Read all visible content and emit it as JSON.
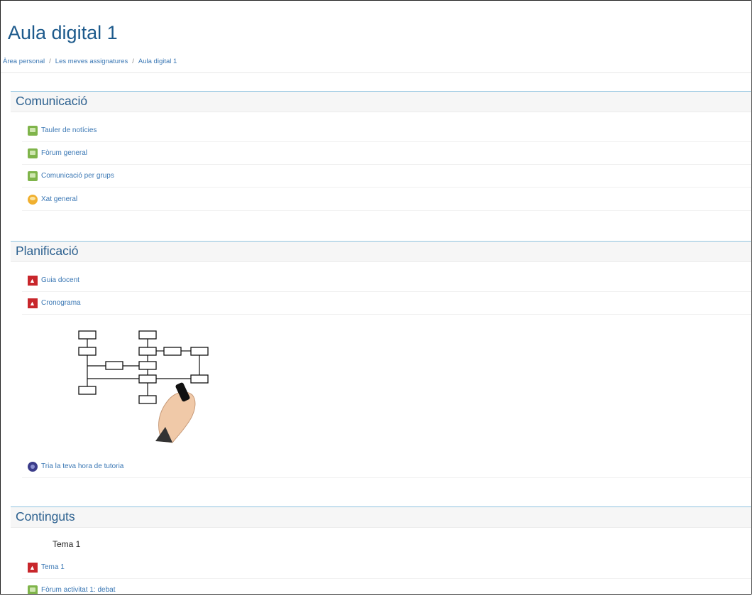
{
  "page": {
    "title": "Aula digital 1",
    "breadcrumb": [
      "Àrea personal",
      "Les meves assignatures",
      "Aula digital 1"
    ],
    "breadcrumb_sep": "/"
  },
  "sections": {
    "comunicacio": {
      "title": "Comunicació",
      "items": [
        {
          "label": "Tauler de notícies",
          "icon": "forum-icon"
        },
        {
          "label": "Fòrum general",
          "icon": "forum-icon"
        },
        {
          "label": "Comunicació per grups",
          "icon": "forum-icon"
        },
        {
          "label": "Xat general",
          "icon": "chat-icon"
        }
      ]
    },
    "planificacio": {
      "title": "Planificació",
      "items": [
        {
          "label": "Guia docent",
          "icon": "pdf-icon"
        },
        {
          "label": "Cronograma",
          "icon": "pdf-icon"
        },
        {
          "label": "Tria la teva hora de tutoria",
          "icon": "scheduler-icon"
        }
      ]
    },
    "continguts": {
      "title": "Continguts",
      "subheading": "Tema 1",
      "items": [
        {
          "label": "Tema 1",
          "icon": "pdf-icon"
        },
        {
          "label": "Fòrum activitat 1: debat",
          "icon": "forum-icon"
        }
      ]
    }
  },
  "colors": {
    "title": "#1d5a8c",
    "link": "#3a77b4",
    "section_border": "#8fc3e0",
    "pdf_red": "#c8262b",
    "forum_green": "#7fb44a"
  }
}
